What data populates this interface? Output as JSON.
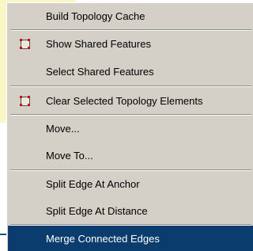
{
  "menu": {
    "items": [
      {
        "label": "Build Topology Cache",
        "icon": null,
        "active": false
      },
      {
        "label": "Show Shared Features",
        "icon": "topology-features-icon",
        "active": false
      },
      {
        "label": "Select Shared Features",
        "icon": null,
        "active": false
      },
      {
        "label": "Clear Selected Topology Elements",
        "icon": "topology-clear-icon",
        "active": false
      },
      {
        "label": "Move...",
        "icon": null,
        "active": false
      },
      {
        "label": "Move To...",
        "icon": null,
        "active": false
      },
      {
        "label": "Split Edge At Anchor",
        "icon": null,
        "active": false
      },
      {
        "label": "Split Edge At Distance",
        "icon": null,
        "active": false
      },
      {
        "label": "Merge Connected Edges",
        "icon": null,
        "active": true
      }
    ]
  },
  "colors": {
    "menu_background": "#d4d0c8",
    "highlight": "#0a3d6e",
    "background_panel": "#fbf6c8"
  }
}
